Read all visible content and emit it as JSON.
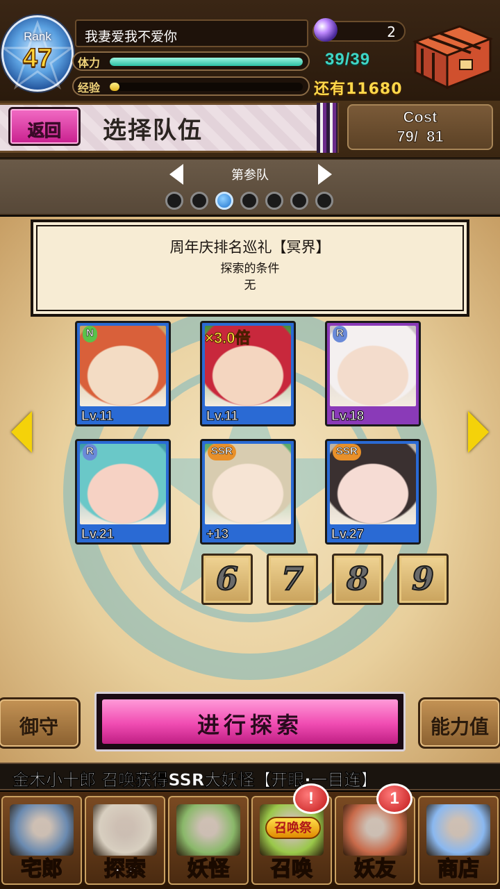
{
  "player": {
    "rank_label": "Rank",
    "rank": "47",
    "name": "我妻爱我不爱你",
    "stamina_label": "体力",
    "stamina_text": "39/39",
    "stamina_fraction": 1.0,
    "exp_label": "经验",
    "exp_fraction": 0.05,
    "orb_count": "2",
    "remaining_text": "还有11680"
  },
  "header": {
    "back_label": "返回",
    "title": "选择队伍",
    "cost_label": "Cost",
    "cost_value": "79/  81"
  },
  "team_pager": {
    "team_name": "第参队",
    "page_count": 7,
    "active_index": 2
  },
  "quest": {
    "title": "周年庆排名巡礼【冥界】",
    "condition_label": "探索的条件",
    "condition_value": "无"
  },
  "cards": [
    {
      "rarity": "N",
      "level": "Lv.11",
      "multiplier": "",
      "frame": "#2a6ad4",
      "rarity_color": "#5ac24a",
      "art_a": "#d9603a",
      "art_b": "#f3dcc4",
      "art_c": "#c8a060"
    },
    {
      "rarity": "",
      "level": "Lv.11",
      "multiplier": "×3.0倍",
      "frame": "#2a6ad4",
      "rarity_color": "",
      "art_a": "#c8283c",
      "art_b": "#f4d6c0",
      "art_c": "#4a8a3a"
    },
    {
      "rarity": "R",
      "level": "Lv.18",
      "multiplier": "",
      "frame": "#8a3ab8",
      "rarity_color": "#6a8ad8",
      "art_a": "#f4f0f0",
      "art_b": "#f3dccc",
      "art_c": "#c8c0c4"
    },
    {
      "rarity": "R",
      "level": "Lv.21",
      "multiplier": "",
      "frame": "#2a6ad4",
      "rarity_color": "#6a8ad8",
      "art_a": "#6ac8c8",
      "art_b": "#f6d2c4",
      "art_c": "#3a9aa8"
    },
    {
      "rarity": "SSR",
      "level": "+13",
      "multiplier": "",
      "frame": "#2a6ad4",
      "rarity_color": "#e8902a",
      "art_a": "#d8ccb0",
      "art_b": "#f6e4d4",
      "art_c": "#5aa86a"
    },
    {
      "rarity": "SSR",
      "level": "Lv.27",
      "multiplier": "",
      "frame": "#2a6ad4",
      "rarity_color": "#e8902a",
      "art_a": "#3a3030",
      "art_b": "#f6dcd4",
      "art_c": "#b8b0a4"
    }
  ],
  "empty_slots": [
    "6",
    "7",
    "8",
    "9"
  ],
  "actions": {
    "left_label": "御守",
    "explore_label": "进行探索",
    "right_label": "能力值"
  },
  "ticker": "金木小十郎 召唤获得SSR大妖怪【开眼·一目连】",
  "nav": [
    {
      "label": "宅郎",
      "icon": "mansion-icon",
      "art": "#6a8ab0",
      "badge": ""
    },
    {
      "label": "探索",
      "icon": "magnifier-map-icon",
      "art": "#d8cfc0",
      "badge": ""
    },
    {
      "label": "妖怪",
      "icon": "scroll-icon",
      "art": "#8ab86a",
      "badge": ""
    },
    {
      "label": "召唤",
      "icon": "summon-star-icon",
      "art": "#9ac84a",
      "badge": "!"
    },
    {
      "label": "妖友",
      "icon": "friend-girl-icon",
      "art": "#c86a4a",
      "badge": "1"
    },
    {
      "label": "商店",
      "icon": "crystal-ball-icon",
      "art": "#8ab8f0",
      "badge": ""
    }
  ],
  "summon_tag": "召唤祭",
  "colors": {
    "accent_pink": "#f04cb2",
    "stamina": "#3fd6c6",
    "gold": "#ffd84a"
  }
}
